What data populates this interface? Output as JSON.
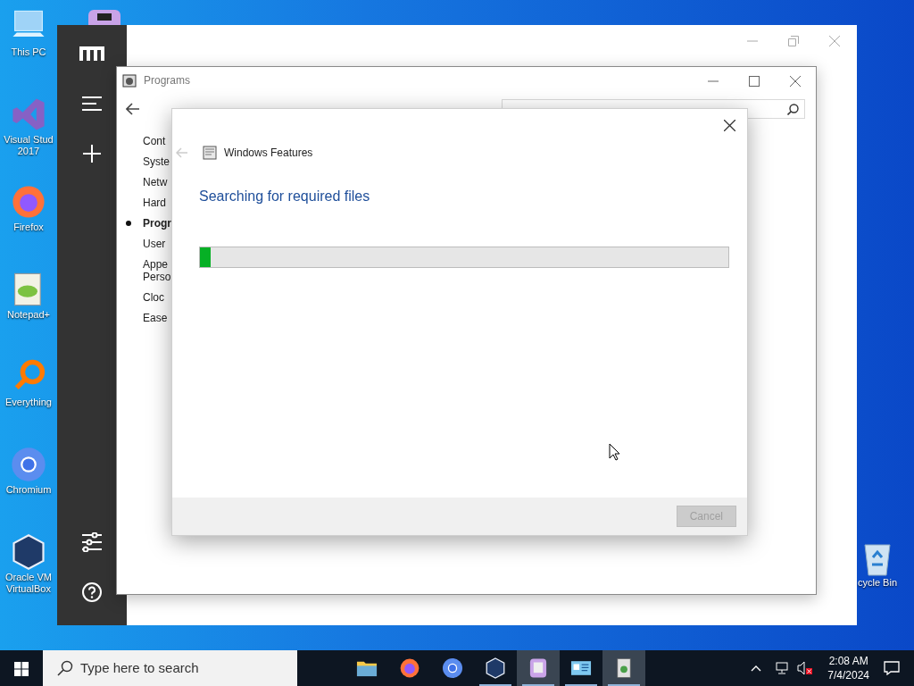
{
  "desktop_icons": [
    {
      "kind": "computer",
      "lines": [
        "This PC"
      ]
    },
    {
      "kind": "studio",
      "lines": [
        "Visual Stud",
        "2017"
      ]
    },
    {
      "kind": "firefox",
      "lines": [
        "Firefox"
      ]
    },
    {
      "kind": "notepad",
      "lines": [
        "Notepad+"
      ]
    },
    {
      "kind": "everything",
      "lines": [
        "Everything"
      ]
    },
    {
      "kind": "chromium",
      "lines": [
        "Chromium"
      ]
    },
    {
      "kind": "virtualbox",
      "lines": [
        "Oracle VM",
        "VirtualBox"
      ]
    }
  ],
  "recycle_bin": {
    "label": "cycle Bin"
  },
  "programs_window": {
    "title": "Programs",
    "nav": [
      {
        "lines": [
          "Cont"
        ],
        "selected": false
      },
      {
        "lines": [
          "Syste"
        ],
        "selected": false
      },
      {
        "lines": [
          "Netw"
        ],
        "selected": false
      },
      {
        "lines": [
          "Hard"
        ],
        "selected": false
      },
      {
        "lines": [
          "Progr"
        ],
        "selected": true
      },
      {
        "lines": [
          "User"
        ],
        "selected": false
      },
      {
        "lines": [
          "Appe",
          "Perso"
        ],
        "selected": false
      },
      {
        "lines": [
          "Cloc"
        ],
        "selected": false
      },
      {
        "lines": [
          "Ease"
        ],
        "selected": false
      }
    ]
  },
  "dialog": {
    "title": "Windows Features",
    "heading": "Searching for required files",
    "progress": {
      "level": 0.02
    },
    "cancel": {
      "label": "Cancel",
      "disabled": true
    }
  },
  "taskbar": {
    "search_placeholder": "Type here to search",
    "apps": [
      {
        "kind": "folder",
        "running": false,
        "selected": false
      },
      {
        "kind": "firefox",
        "running": false,
        "selected": false
      },
      {
        "kind": "chromium",
        "running": false,
        "selected": false
      },
      {
        "kind": "virtualbox",
        "running": true,
        "selected": false
      },
      {
        "kind": "notes",
        "running": true,
        "selected": true
      },
      {
        "kind": "control-panel",
        "running": true,
        "selected": false
      },
      {
        "kind": "features",
        "running": true,
        "selected": true
      }
    ],
    "time": "2:08 AM",
    "date": "7/4/2024"
  }
}
